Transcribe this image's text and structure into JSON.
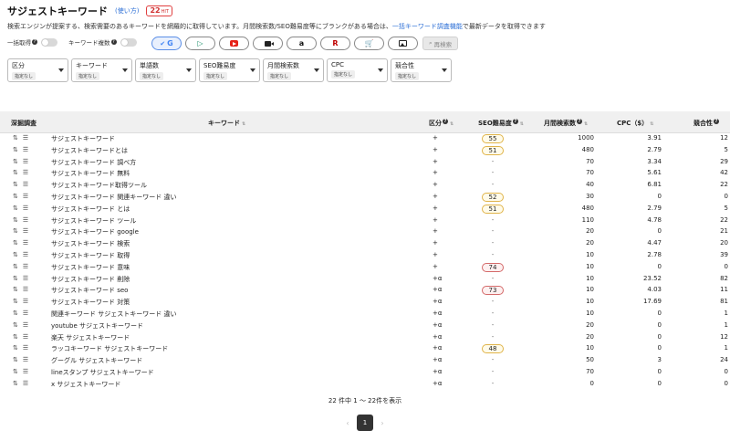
{
  "header": {
    "title": "サジェストキーワード",
    "howto": "(使い方)",
    "hits": "22",
    "hits_unit": "HIT"
  },
  "description": {
    "text_before": "検索エンジンが提案する、検索需要のあるキーワードを網羅的に取得しています。月間検索数/SEO難易度等にブランクがある場合は、",
    "link": "一括キーワード調査機能",
    "text_after": "で最新データを取得できます"
  },
  "toggles": [
    {
      "label": "一括取得"
    },
    {
      "label": "キーワード複数"
    }
  ],
  "engines": [
    {
      "name": "google",
      "glyph": "G",
      "active": true
    },
    {
      "name": "bing",
      "glyph": "▷",
      "active": false
    },
    {
      "name": "youtube",
      "glyph": "",
      "active": false
    },
    {
      "name": "video",
      "glyph": "",
      "active": false
    },
    {
      "name": "amazon",
      "glyph": "a",
      "active": false
    },
    {
      "name": "rakuten",
      "glyph": "R",
      "active": false
    },
    {
      "name": "shopping",
      "glyph": "🛒",
      "active": false
    },
    {
      "name": "image",
      "glyph": "",
      "active": false
    }
  ],
  "research_button": "再検索",
  "filters": [
    {
      "title": "区分",
      "value": "指定なし"
    },
    {
      "title": "キーワード",
      "value": "指定なし"
    },
    {
      "title": "単語数",
      "value": "指定なし"
    },
    {
      "title": "SEO難易度",
      "value": "指定なし"
    },
    {
      "title": "月間検索数",
      "value": "指定なし"
    },
    {
      "title": "CPC",
      "value": "指定なし"
    },
    {
      "title": "競合性",
      "value": "指定なし"
    }
  ],
  "table": {
    "columns": {
      "deep": "深掘調査",
      "keyword": "キーワード",
      "kind": "区分",
      "seo": "SEO難易度",
      "volume": "月間検索数",
      "cpc": "CPC（$）",
      "competition": "競合性"
    },
    "rows": [
      {
        "kw": "サジェストキーワード",
        "kind": "+",
        "seo": "55",
        "seo_level": "yellow",
        "vol": "1000",
        "cpc": "3.91",
        "comp": "12"
      },
      {
        "kw": "サジェストキーワードとは",
        "kind": "+",
        "seo": "51",
        "seo_level": "yellow",
        "vol": "480",
        "cpc": "2.79",
        "comp": "5"
      },
      {
        "kw": "サジェストキーワード 調べ方",
        "kind": "+",
        "seo": "-",
        "seo_level": "",
        "vol": "70",
        "cpc": "3.34",
        "comp": "29"
      },
      {
        "kw": "サジェストキーワード 無料",
        "kind": "+",
        "seo": "-",
        "seo_level": "",
        "vol": "70",
        "cpc": "5.61",
        "comp": "42"
      },
      {
        "kw": "サジェストキーワード取得ツール",
        "kind": "+",
        "seo": "-",
        "seo_level": "",
        "vol": "40",
        "cpc": "6.81",
        "comp": "22"
      },
      {
        "kw": "サジェストキーワード 関連キーワード 違い",
        "kind": "+",
        "seo": "52",
        "seo_level": "yellow",
        "vol": "30",
        "cpc": "0",
        "comp": "0"
      },
      {
        "kw": "サジェストキーワード とは",
        "kind": "+",
        "seo": "51",
        "seo_level": "yellow",
        "vol": "480",
        "cpc": "2.79",
        "comp": "5"
      },
      {
        "kw": "サジェストキーワード ツール",
        "kind": "+",
        "seo": "-",
        "seo_level": "",
        "vol": "110",
        "cpc": "4.78",
        "comp": "22"
      },
      {
        "kw": "サジェストキーワード google",
        "kind": "+",
        "seo": "-",
        "seo_level": "",
        "vol": "20",
        "cpc": "0",
        "comp": "21"
      },
      {
        "kw": "サジェストキーワード 検索",
        "kind": "+",
        "seo": "-",
        "seo_level": "",
        "vol": "20",
        "cpc": "4.47",
        "comp": "20"
      },
      {
        "kw": "サジェストキーワード 取得",
        "kind": "+",
        "seo": "-",
        "seo_level": "",
        "vol": "10",
        "cpc": "2.78",
        "comp": "39"
      },
      {
        "kw": "サジェストキーワード 意味",
        "kind": "+",
        "seo": "74",
        "seo_level": "red",
        "vol": "10",
        "cpc": "0",
        "comp": "0"
      },
      {
        "kw": "サジェストキーワード 削除",
        "kind": "+α",
        "seo": "-",
        "seo_level": "",
        "vol": "10",
        "cpc": "23.52",
        "comp": "82"
      },
      {
        "kw": "サジェストキーワード seo",
        "kind": "+α",
        "seo": "73",
        "seo_level": "red",
        "vol": "10",
        "cpc": "4.03",
        "comp": "11"
      },
      {
        "kw": "サジェストキーワード 対策",
        "kind": "+α",
        "seo": "-",
        "seo_level": "",
        "vol": "10",
        "cpc": "17.69",
        "comp": "81"
      },
      {
        "kw": "関連キーワード サジェストキーワード 違い",
        "kind": "+α",
        "seo": "-",
        "seo_level": "",
        "vol": "10",
        "cpc": "0",
        "comp": "1"
      },
      {
        "kw": "youtube サジェストキーワード",
        "kind": "+α",
        "seo": "-",
        "seo_level": "",
        "vol": "20",
        "cpc": "0",
        "comp": "1"
      },
      {
        "kw": "楽天 サジェストキーワード",
        "kind": "+α",
        "seo": "-",
        "seo_level": "",
        "vol": "20",
        "cpc": "0",
        "comp": "12"
      },
      {
        "kw": "ラッコキーワード サジェストキーワード",
        "kind": "+α",
        "seo": "48",
        "seo_level": "yellow",
        "vol": "10",
        "cpc": "0",
        "comp": "1"
      },
      {
        "kw": "グーグル サジェストキーワード",
        "kind": "+α",
        "seo": "-",
        "seo_level": "",
        "vol": "50",
        "cpc": "3",
        "comp": "24"
      },
      {
        "kw": "lineスタンプ サジェストキーワード",
        "kind": "+α",
        "seo": "-",
        "seo_level": "",
        "vol": "70",
        "cpc": "0",
        "comp": "0"
      },
      {
        "kw": "x サジェストキーワード",
        "kind": "+α",
        "seo": "-",
        "seo_level": "",
        "vol": "0",
        "cpc": "0",
        "comp": "0"
      }
    ]
  },
  "summary": "22 件中 1 〜 22件を表示",
  "pagination": {
    "current": "1",
    "prev": "‹",
    "next": "›"
  }
}
